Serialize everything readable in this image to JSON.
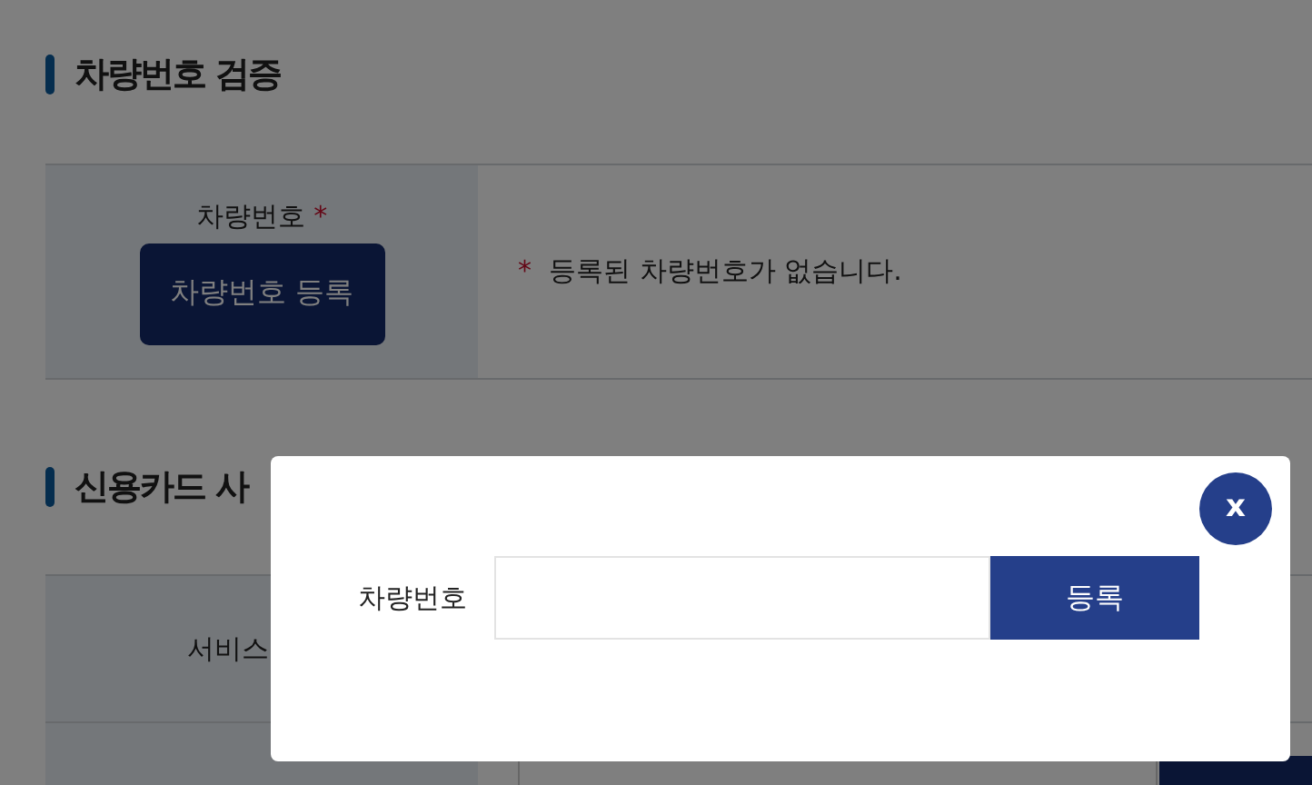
{
  "sections": [
    {
      "title": "차량번호 검증",
      "rows": [
        {
          "label": "차량번호",
          "required": true,
          "button": "차량번호 등록",
          "notice_mark": "*",
          "notice": "등록된 차량번호가 없습니다."
        }
      ]
    },
    {
      "title": "신용카드 사",
      "rows": [
        {
          "kind": "label",
          "label": "서비스"
        },
        {
          "kind": "field"
        }
      ]
    }
  ],
  "modal": {
    "label": "차량번호",
    "submit": "등록",
    "close": "x"
  }
}
